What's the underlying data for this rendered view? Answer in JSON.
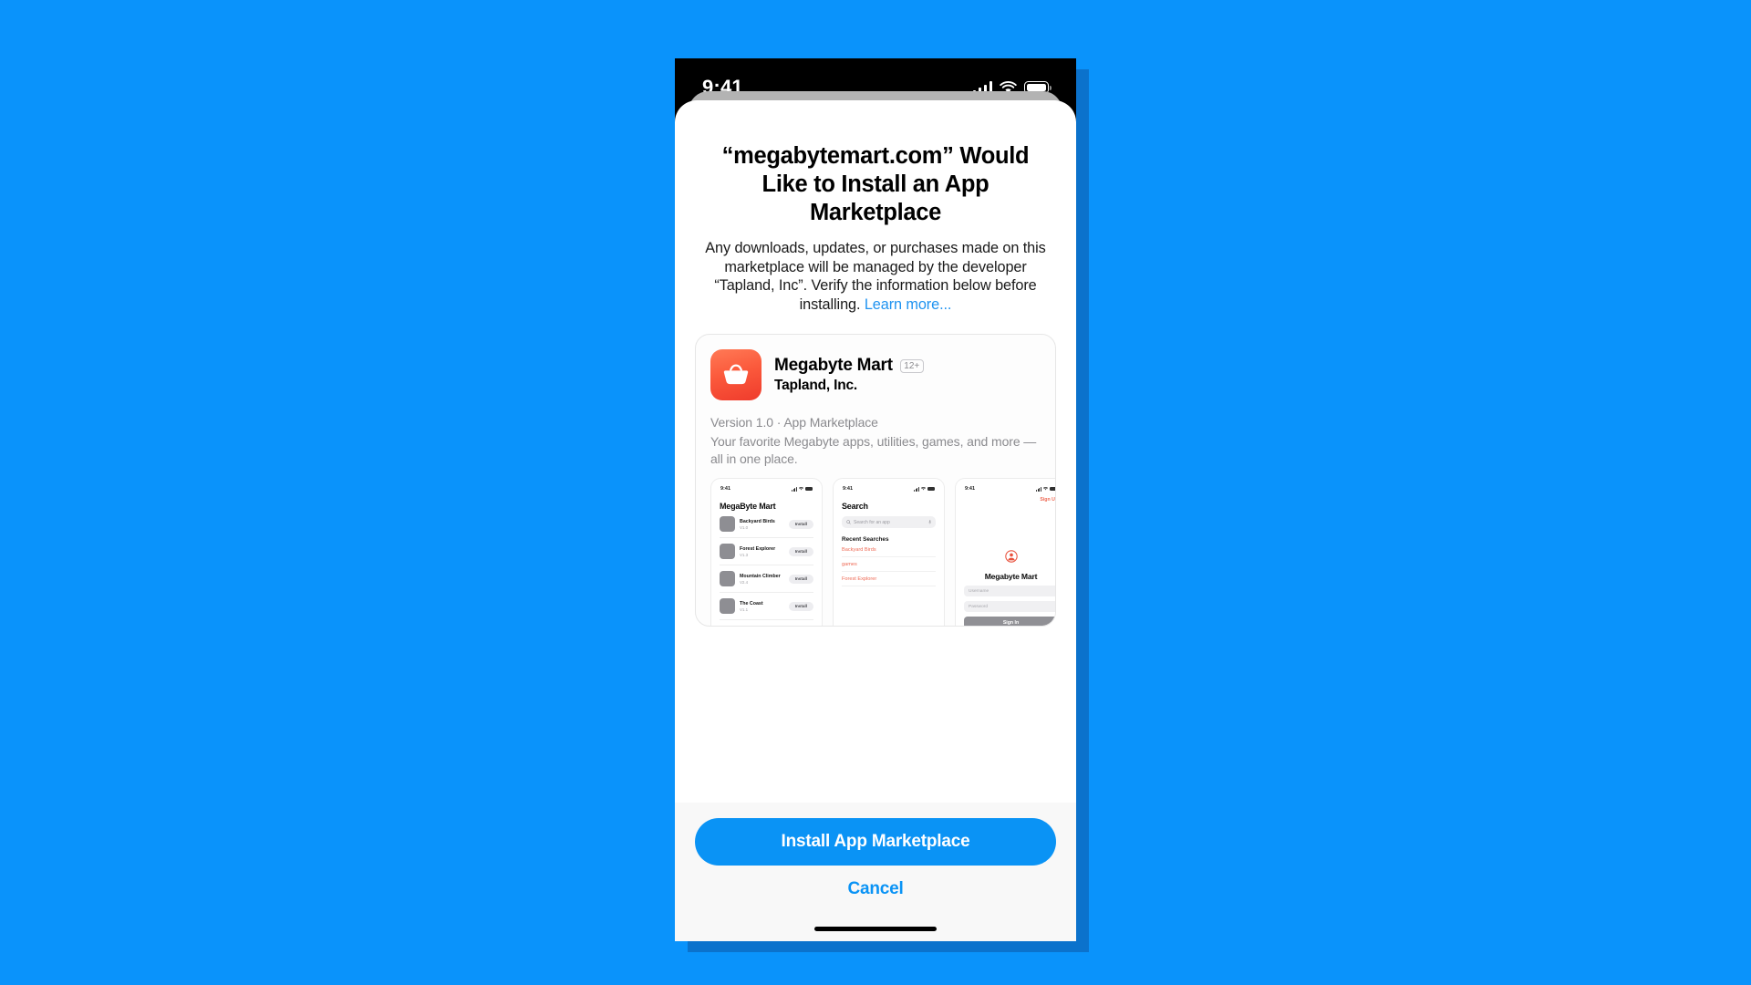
{
  "background": {
    "page_color": "#0a93fb",
    "shadow_color": "#0b72cc"
  },
  "status_bar": {
    "time": "9:41",
    "icons": [
      "cellular-signal-icon",
      "wifi-icon",
      "battery-icon"
    ]
  },
  "sheet": {
    "title": "“megabytemart.com” Would Like to Install an App Marketplace",
    "body_text": "Any downloads, updates, or purchases made on this marketplace will be managed by the developer “Tapland, Inc”. Verify the information below before installing. ",
    "learn_more_label": "Learn more...",
    "learn_more_color": "#1f93f0"
  },
  "app_card": {
    "icon_name": "shopping-basket-icon",
    "icon_gradient": [
      "#ff7a56",
      "#ef3b2c"
    ],
    "name": "Megabyte Mart",
    "age_rating": "12+",
    "developer": "Tapland, Inc.",
    "version_line": "Version 1.0 · App Marketplace",
    "description": "Your favorite Megabyte apps, utilities, games, and more — all in one place."
  },
  "screenshots": [
    {
      "name": "app-list-screenshot",
      "status_time": "9:41",
      "heading": "MegaByte Mart",
      "rows": [
        {
          "name": "Backyard Birds",
          "version": "V1.0",
          "button": "Install"
        },
        {
          "name": "Forest Explorer",
          "version": "V1.3",
          "button": "Install"
        },
        {
          "name": "Mountain Climber",
          "version": "V2.4",
          "button": "Install"
        },
        {
          "name": "The Coast",
          "version": "V1.1",
          "button": "Install"
        }
      ]
    },
    {
      "name": "search-screenshot",
      "status_time": "9:41",
      "heading": "Search",
      "search_placeholder": "Search for an app",
      "section_heading": "Recent Searches",
      "recent": [
        "Backyard Birds",
        "games",
        "Forest Explorer"
      ],
      "accent_color": "#ee6a55"
    },
    {
      "name": "sign-in-screenshot",
      "status_time": "9:41",
      "sign_up_label": "Sign Up",
      "title": "Megabyte Mart",
      "username_placeholder": "Username",
      "password_placeholder": "Password",
      "sign_in_label": "Sign In",
      "accent_color": "#ee6a55"
    }
  ],
  "actions": {
    "install_label": "Install App Marketplace",
    "cancel_label": "Cancel",
    "primary_color": "#0a93f5"
  }
}
